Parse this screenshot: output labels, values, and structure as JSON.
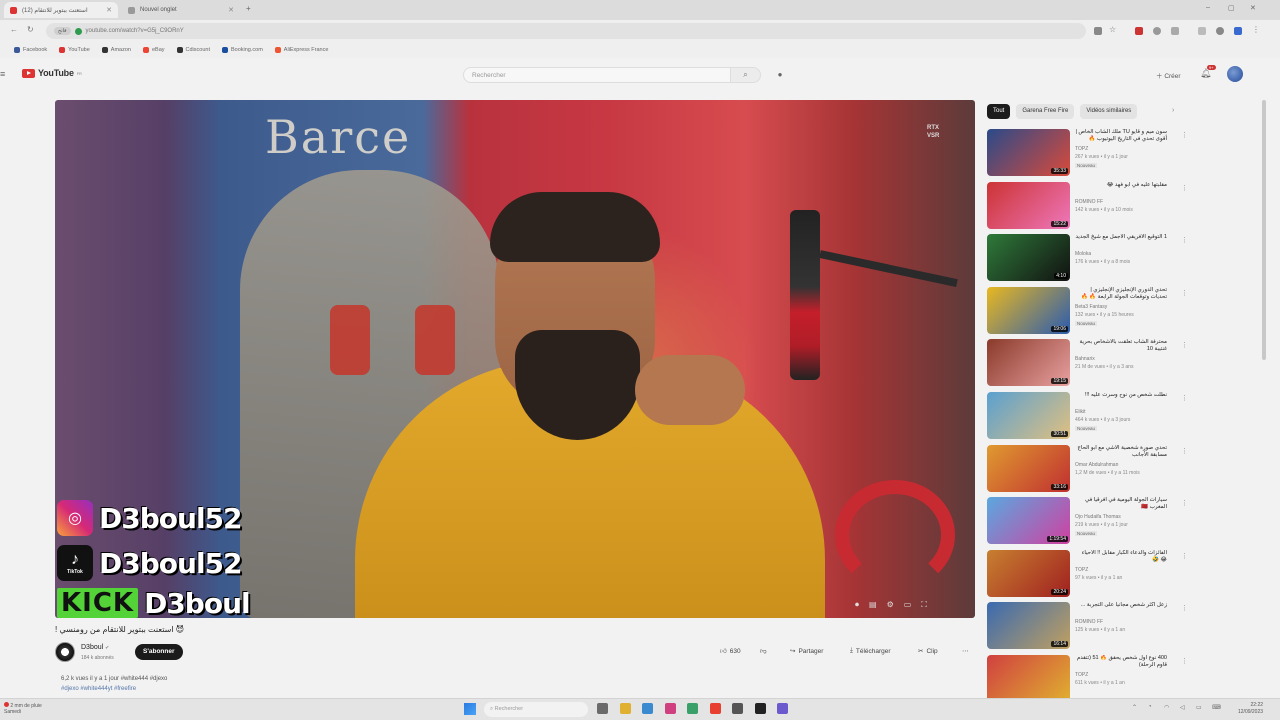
{
  "browser": {
    "tabs": [
      {
        "label": "استعنت ببتوير للانتقام (12)",
        "favicon_color": "#d33",
        "active": true
      },
      {
        "label": "Nouvel onglet",
        "favicon_color": "#999",
        "active": false
      }
    ],
    "new_tab": "+",
    "window_controls": [
      "–",
      "▢",
      "✕"
    ],
    "url_pill": "فاتح",
    "url": "youtube.com/watch?v=G5j_C9ORnY",
    "bookmarks": [
      {
        "label": "Facebook",
        "color": "#3b5998"
      },
      {
        "label": "YouTube",
        "color": "#d33"
      },
      {
        "label": "Amazon",
        "color": "#333"
      },
      {
        "label": "eBay",
        "color": "#e43"
      },
      {
        "label": "Cdiscount",
        "color": "#333"
      },
      {
        "label": "Booking.com",
        "color": "#1a4fa0"
      },
      {
        "label": "AliExpress France",
        "color": "#e53"
      }
    ]
  },
  "youtube": {
    "logo": "YouTube",
    "logo_region": "FR",
    "search_placeholder": "Rechercher",
    "create_label": "Créer",
    "notif_count": "9+"
  },
  "player": {
    "banner_text": "Barce",
    "badge_line1": "RTX",
    "badge_line2": "VSR",
    "socials": [
      {
        "platform": "instagram",
        "handle": "D3boul52"
      },
      {
        "platform": "tiktok",
        "handle": "D3boul52",
        "platform_label": "TikTok"
      },
      {
        "platform": "kick",
        "handle": "D3boul",
        "platform_label": "KICK"
      }
    ]
  },
  "video": {
    "title": "😈 استعنت ببتوير للانتقام من رومنسي !",
    "channel": "D3boul",
    "subscribers": "184 k abonnés",
    "subscribe_label": "S'abonner",
    "likes": "630",
    "share_label": "Partager",
    "download_label": "Télécharger",
    "clip_label": "Clip",
    "meta": "6,2 k vues  il y a 1 jour  #white444 #djexo",
    "hashtags": "#djexo #white444yt #freefire"
  },
  "sidebar": {
    "chips": [
      "Tout",
      "Garena Free Fire",
      "Vidéos similaires"
    ],
    "recommendations": [
      {
        "title": "سون ميم و قايو TU ملك الشاب الخاص | أقوى تحدي في التاريخ اليوتيوب 🔥",
        "channel": "TOPZ",
        "views": "267 k vues • il y a 1 jour",
        "badge": "Nouveau",
        "duration": "35:33",
        "colors": [
          "#2a4a8a",
          "#d94a3a"
        ]
      },
      {
        "title": "مقلبتها عليه في ابو فهد 😂",
        "channel": "ROMINO FF",
        "views": "142 k vues • il y a 10 mois",
        "badge": "",
        "duration": "15:22",
        "colors": [
          "#c33",
          "#e7b"
        ]
      },
      {
        "title": "1 التوقيع الأفريقي الأجمل مع شيخ الجديد",
        "channel": "Moloka",
        "views": "176 k vues • il y a 8 mois",
        "badge": "",
        "duration": "4:10",
        "colors": [
          "#2f7a3a",
          "#111"
        ]
      },
      {
        "title": "تحدي الدوري الإنجليزي الإنجليزي | تحديات وتوقعات الجولة الرابعة 🔥 🔥 الرابع",
        "channel": "Beta3 Fantasy",
        "views": "132 vues • il y a 15 heures",
        "badge": "Nouveau",
        "duration": "19:06",
        "colors": [
          "#e9b820",
          "#2a5bb0"
        ]
      },
      {
        "title": "محترفة الشاب تعلقت بالاشخاص بحرية غنتيبة 10",
        "channel": "Bahnarix",
        "views": "21 M de vues • il y a 3 ans",
        "badge": "",
        "duration": "19:15",
        "colors": [
          "#8a3a2a",
          "#e8a0a0"
        ]
      },
      {
        "title": "نطلت شخص من نوح وسرت عليه !!!",
        "channel": "Elikit",
        "views": "464 k vues • il y a 3 jours",
        "badge": "Nouveau",
        "duration": "30:51",
        "colors": [
          "#5aa0d0",
          "#e0c080"
        ]
      },
      {
        "title": "تحدي صورة شخصية الأشي مع أبو الحاج مسابقة الأجانب",
        "channel": "Omar Abdulrahman",
        "views": "1,2 M de vues • il y a 11 mois",
        "badge": "",
        "duration": "33:16",
        "colors": [
          "#e09a30",
          "#c03030"
        ]
      },
      {
        "title": "سيارات الجولة اليومية في أفرقيا في المغرب 🇲🇦",
        "channel": "Ojo Hudaifa Thomas",
        "views": "219 k vues • il y a 1 jour",
        "badge": "Nouveau",
        "duration": "1:19:54",
        "colors": [
          "#5aa8e0",
          "#d040a0"
        ]
      },
      {
        "title": "الفائزات والدعاء الكبار مقابل !! الأحياء 😂 🤣",
        "channel": "TOPZ",
        "views": "97 k vues • il y a 1 an",
        "badge": "",
        "duration": "20:24",
        "colors": [
          "#c88030",
          "#a02020"
        ]
      },
      {
        "title": "زعل أكثر شخص مجانيا على التجربة ...",
        "channel": "ROMINO FF",
        "views": "125 k vues • il y a 1 an",
        "badge": "",
        "duration": "16:14",
        "colors": [
          "#3a6ab0",
          "#c0a060"
        ]
      },
      {
        "title": "400 نوع أول شخص يحقق 🔥 51 (تتقدم قاوم الرحلة)",
        "channel": "TOPZ",
        "views": "611 k vues • il y a 1 an",
        "badge": "",
        "duration": "",
        "colors": [
          "#d04040",
          "#e0b030"
        ]
      }
    ]
  },
  "taskbar": {
    "weather_line1": "2 mm de pluie",
    "weather_line2": "Samedi",
    "search_placeholder": "Rechercher",
    "time": "22:22",
    "date": "12/09/2023",
    "apps": [
      "#6a6a6a",
      "#e0b030",
      "#3a8ad0",
      "#d04080",
      "#3aa06a",
      "#e84030",
      "#555",
      "#222",
      "#6a5acd"
    ]
  }
}
